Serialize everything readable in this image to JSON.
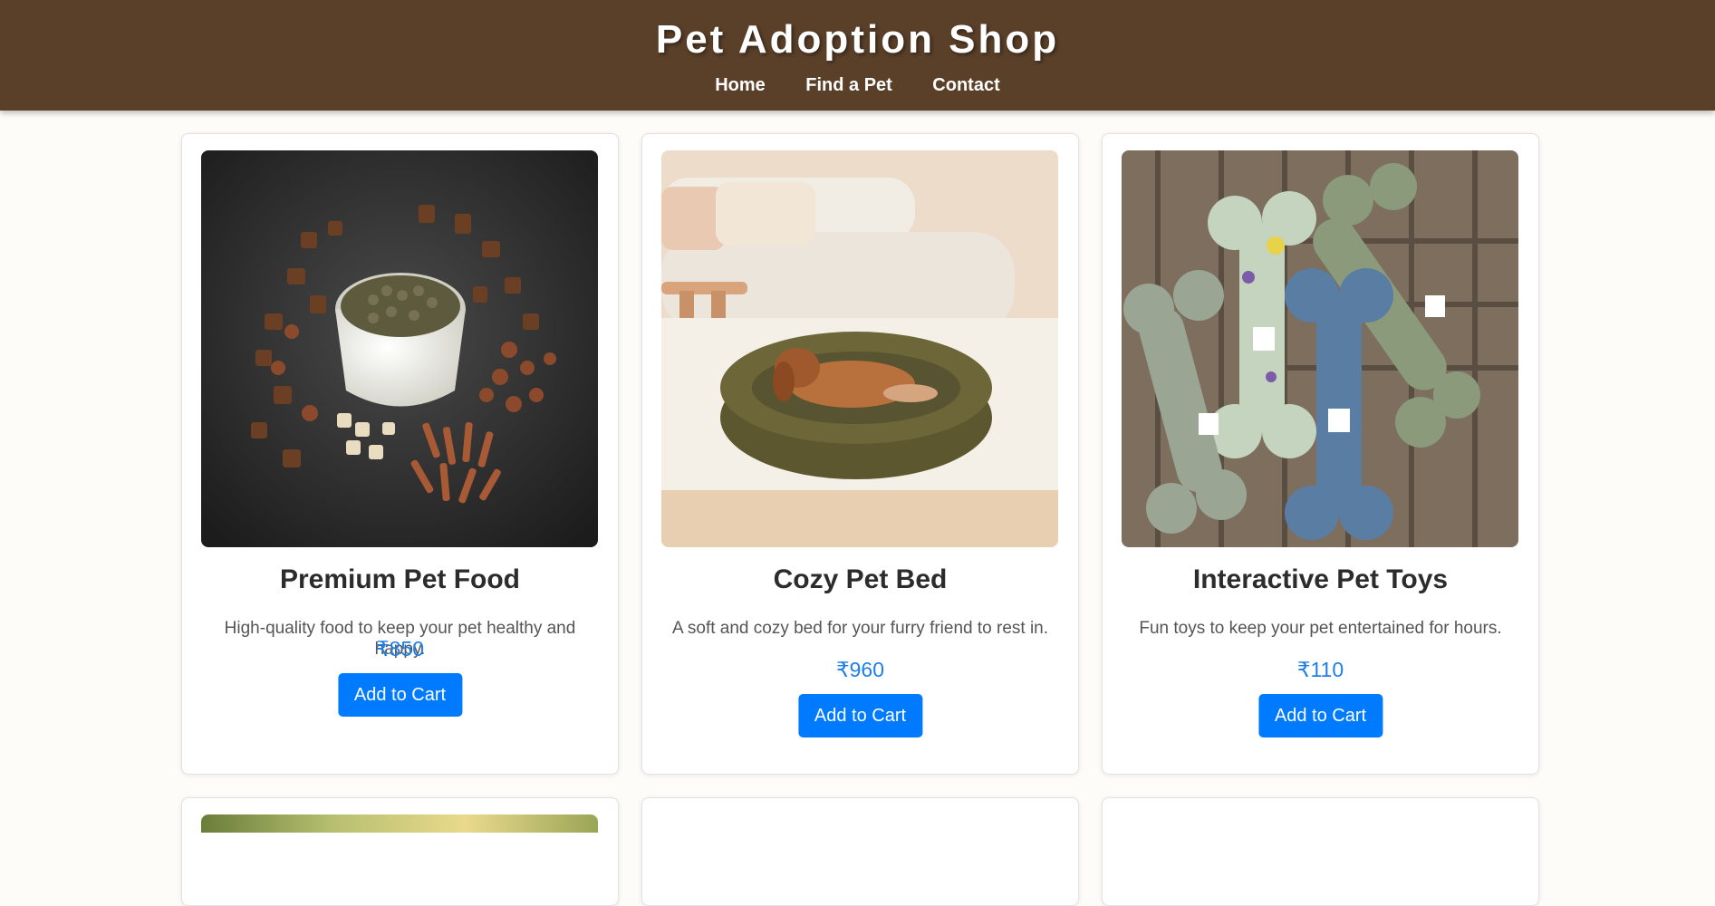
{
  "header": {
    "title": "Pet Adoption Shop",
    "nav": [
      "Home",
      "Find a Pet",
      "Contact"
    ]
  },
  "products": [
    {
      "name": "Premium Pet Food",
      "description": "High-quality food to keep your pet healthy and happy.",
      "price": "₹850",
      "button": "Add to Cart",
      "image": "pet-food-bowl-photo"
    },
    {
      "name": "Cozy Pet Bed",
      "description": "A soft and cozy bed for your furry friend to rest in.",
      "price": "₹960",
      "button": "Add to Cart",
      "image": "dog-in-bed-photo"
    },
    {
      "name": "Interactive Pet Toys",
      "description": "Fun toys to keep your pet entertained for hours.",
      "price": "₹110",
      "button": "Add to Cart",
      "image": "bone-plush-toys-photo"
    }
  ],
  "colors": {
    "header_bg": "#5b4029",
    "accent": "#007bff",
    "price": "#1f7fe8",
    "page_bg": "#fdfcf9"
  }
}
